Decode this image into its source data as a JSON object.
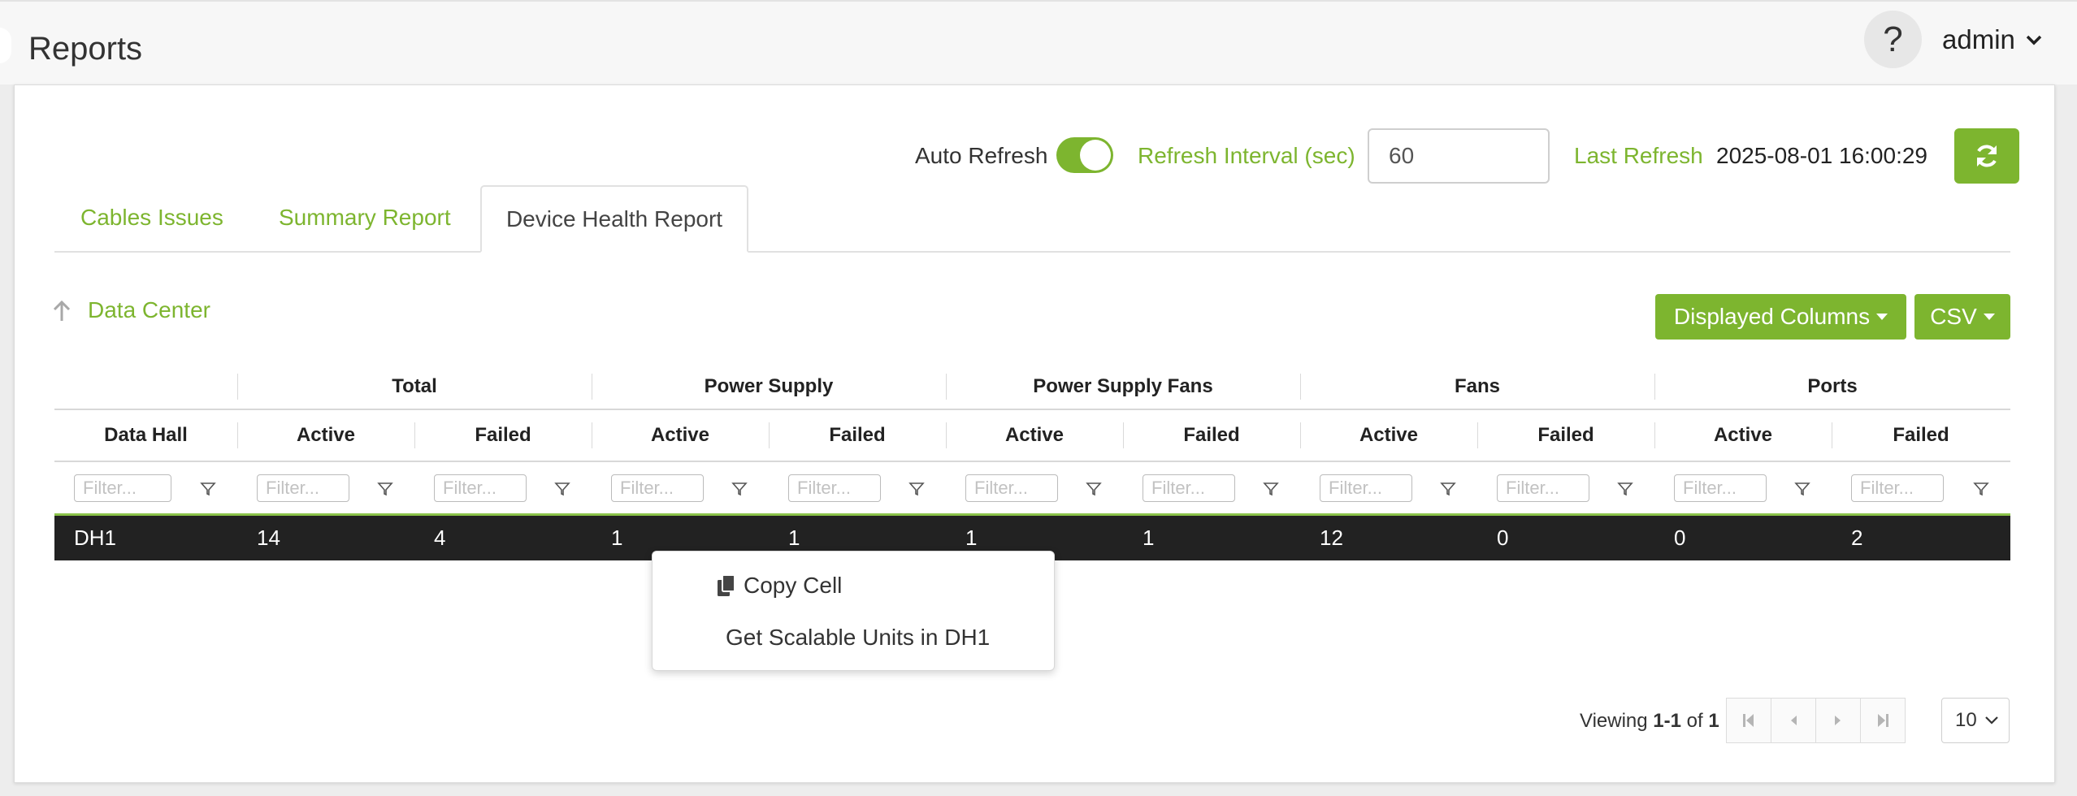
{
  "header": {
    "title": "Reports",
    "help_label": "?",
    "user": "admin"
  },
  "toolbar": {
    "auto_refresh_label": "Auto Refresh",
    "auto_refresh_on": true,
    "refresh_interval_label": "Refresh Interval (sec)",
    "refresh_interval_value": "60",
    "last_refresh_label": "Last Refresh",
    "last_refresh_value": "2025-08-01 16:00:29"
  },
  "tabs": [
    {
      "label": "Cables Issues",
      "active": false
    },
    {
      "label": "Summary Report",
      "active": false
    },
    {
      "label": "Device Health Report",
      "active": true
    }
  ],
  "breadcrumb": {
    "label": "Data Center"
  },
  "buttons": {
    "displayed_columns": "Displayed Columns",
    "csv": "CSV"
  },
  "table": {
    "groups": [
      "",
      "Total",
      "Power Supply",
      "Power Supply Fans",
      "Fans",
      "Ports"
    ],
    "columns": [
      "Data Hall",
      "Active",
      "Failed",
      "Active",
      "Failed",
      "Active",
      "Failed",
      "Active",
      "Failed",
      "Active",
      "Failed"
    ],
    "filter_placeholder": "Filter...",
    "rows": [
      [
        "DH1",
        "14",
        "4",
        "1",
        "1",
        "1",
        "1",
        "12",
        "0",
        "0",
        "2"
      ]
    ]
  },
  "context_menu": {
    "items": [
      "Copy Cell",
      "Get Scalable Units in DH1"
    ]
  },
  "pagination": {
    "viewing_prefix": "Viewing",
    "range": "1-1",
    "of_label": "of",
    "total": "1",
    "page_size": "10"
  },
  "colors": {
    "accent": "#7db52f",
    "row_selected_bg": "#222222"
  }
}
